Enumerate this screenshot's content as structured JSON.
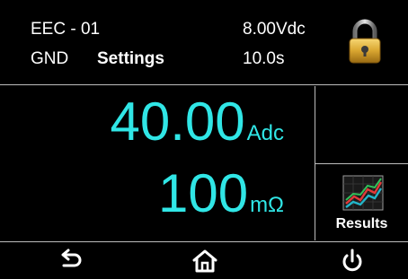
{
  "header": {
    "test_name": "EEC - 01",
    "mode": "GND",
    "page": "Settings",
    "voltage": "8.00Vdc",
    "time": "10.0s",
    "lock_icon": "padlock-locked-icon"
  },
  "readings": {
    "current_value": "40.00",
    "current_unit": "Adc",
    "resistance_value": "100",
    "resistance_unit": "mΩ"
  },
  "results_button": {
    "label": "Results",
    "icon": "line-chart-icon"
  },
  "footer": {
    "back_icon": "back-arrow-icon",
    "home_icon": "home-icon",
    "power_icon": "power-icon"
  },
  "colors": {
    "reading": "#30e6e6",
    "background": "#000000",
    "divider": "#bdbdbd"
  }
}
